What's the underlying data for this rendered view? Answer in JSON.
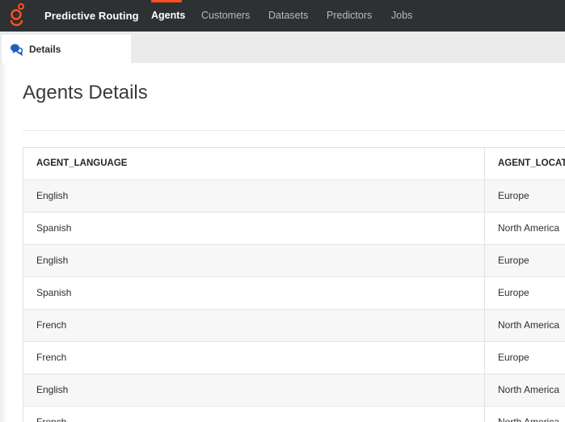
{
  "nav": {
    "brand": "Predictive Routing",
    "items": [
      {
        "label": "Agents",
        "active": true
      },
      {
        "label": "Customers",
        "active": false
      },
      {
        "label": "Datasets",
        "active": false
      },
      {
        "label": "Predictors",
        "active": false
      },
      {
        "label": "Jobs",
        "active": false
      }
    ],
    "accent_color": "#ff4f1f",
    "background_color": "#2d3133"
  },
  "tabs": [
    {
      "label": "Details",
      "icon": "chat-bubbles-icon",
      "active": true
    }
  ],
  "page": {
    "title": "Agents Details"
  },
  "table": {
    "columns": [
      "AGENT_LANGUAGE",
      "AGENT_LOCATI"
    ],
    "rows": [
      [
        "English",
        "Europe"
      ],
      [
        "Spanish",
        "North America"
      ],
      [
        "English",
        "Europe"
      ],
      [
        "Spanish",
        "Europe"
      ],
      [
        "French",
        "North America"
      ],
      [
        "French",
        "Europe"
      ],
      [
        "English",
        "North America"
      ],
      [
        "French",
        "North America"
      ]
    ]
  }
}
